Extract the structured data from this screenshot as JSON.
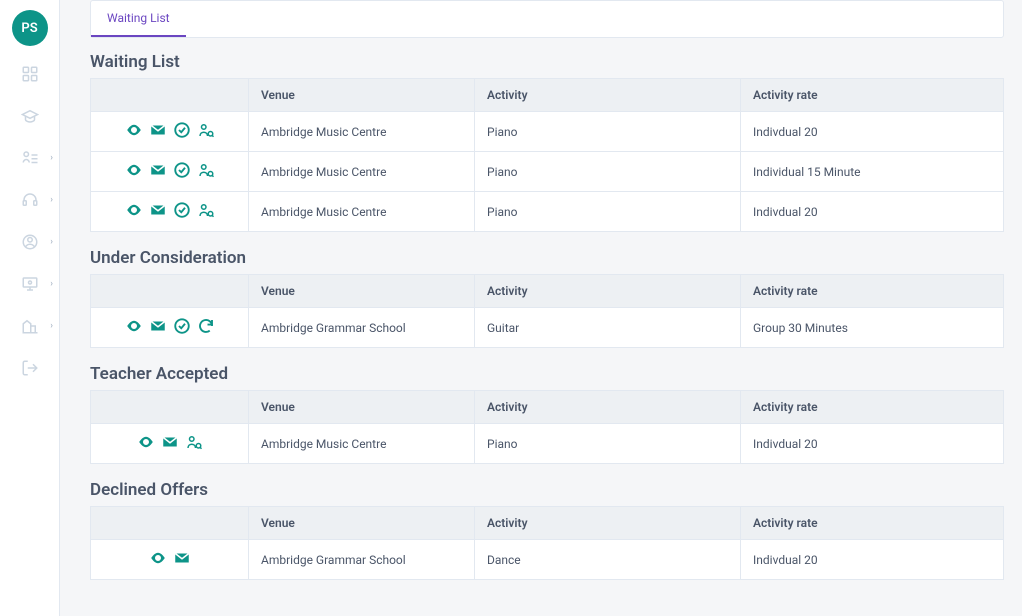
{
  "sidebar": {
    "avatar_initials": "PS"
  },
  "tabs": {
    "waiting_list": "Waiting List"
  },
  "columns": {
    "venue": "Venue",
    "activity": "Activity",
    "rate": "Activity rate"
  },
  "sections": {
    "waiting_list": {
      "title": "Waiting List",
      "rows": [
        {
          "venue": "Ambridge Music Centre",
          "activity": "Piano",
          "rate": "Indivdual 20"
        },
        {
          "venue": "Ambridge Music Centre",
          "activity": "Piano",
          "rate": "Individual 15 Minute"
        },
        {
          "venue": "Ambridge Music Centre",
          "activity": "Piano",
          "rate": "Indivdual 20"
        }
      ]
    },
    "under_consideration": {
      "title": "Under Consideration",
      "rows": [
        {
          "venue": "Ambridge Grammar School",
          "activity": "Guitar",
          "rate": "Group 30 Minutes"
        }
      ]
    },
    "teacher_accepted": {
      "title": "Teacher Accepted",
      "rows": [
        {
          "venue": "Ambridge Music Centre",
          "activity": "Piano",
          "rate": "Indivdual 20"
        }
      ]
    },
    "declined_offers": {
      "title": "Declined Offers",
      "rows": [
        {
          "venue": "Ambridge Grammar School",
          "activity": "Dance",
          "rate": "Indivdual 20"
        }
      ]
    }
  }
}
